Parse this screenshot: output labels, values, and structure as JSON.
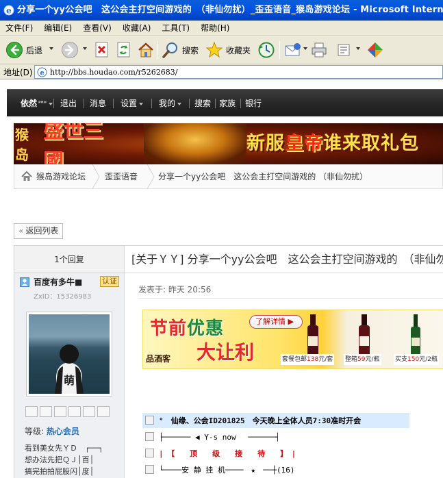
{
  "window": {
    "title": "分享一个yy公会吧　这公会主打空间游戏的　（非仙勿扰）_歪歪语音_猴岛游戏论坛 - Microsoft Internet Explorer"
  },
  "menu": {
    "items": [
      "文件(F)",
      "编辑(E)",
      "查看(V)",
      "收藏(A)",
      "工具(T)",
      "帮助(H)"
    ]
  },
  "toolbar": {
    "back_label": "后退",
    "search_label": "搜索",
    "favorites_label": "收藏夹"
  },
  "address": {
    "label": "地址(D)",
    "url": "http://bbs.houdao.com/r5262683/"
  },
  "site_nav": {
    "user": "依然",
    "user_sup": "ᴾᴿᴼ",
    "items": [
      "退出",
      "消息",
      "设置",
      "我的",
      "搜索",
      "家族",
      "银行"
    ]
  },
  "banner": {
    "brand": "猴岛",
    "game": "盛世三國",
    "slogan_a": "新服",
    "slogan_b": "皇帝",
    "slogan_c": "谁来取",
    "slogan_d": "礼包"
  },
  "breadcrumb": {
    "items": [
      "猴岛游戏论坛",
      "歪歪语音",
      "分享一个yy公会吧　这公会主打空间游戏的 （非仙勿扰）"
    ]
  },
  "back_button": {
    "arrow": "«",
    "label": "返回列表"
  },
  "thread": {
    "reply_count": "1个回复",
    "title": "[关于ＹＹ] 分享一个yy公会吧　这公会主打空间游戏的　（非仙勿扰）"
  },
  "author": {
    "name": "百度有多牛■",
    "badge": "认证",
    "zxid": "ZxID：15326983",
    "level_label": "等级:",
    "level_value": "热心会员",
    "signature": [
      "看到美女先ＹＤ　┌──┐",
      "想办法先把ＱＪ│百│",
      "搞完拍拍屁股闪│度│"
    ]
  },
  "post": {
    "posted_at": "发表于: 昨天 20:56",
    "ad": {
      "line1a": "节前",
      "line1b": "优惠",
      "line2": "大让利",
      "brand": "品酒客",
      "button": "了解详情 ▶",
      "tags": [
        {
          "pre": "套餐包邮",
          "price": "138",
          "unit": "元/套"
        },
        {
          "pre": "整箱",
          "price": "59",
          "unit": "元/瓶"
        },
        {
          "pre": "买支",
          "price": "150",
          "unit": "元/2瓶"
        }
      ]
    },
    "lines": [
      "°　仙缘、公会ID201825　今天晚上全体人员7:30准时开会",
      "├────── ◀ Y-s now　 ──────┤",
      "|　【　　顶　　级　　接　　待　　】　|",
      "└────安 静 挂 机────　★　──┼(16)"
    ]
  },
  "colors": {
    "title_bar": "#0054e3",
    "chrome": "#ece9d8",
    "site_nav": "#262626",
    "author_bg": "#eef0f3",
    "highlight": "#d9ecff"
  }
}
